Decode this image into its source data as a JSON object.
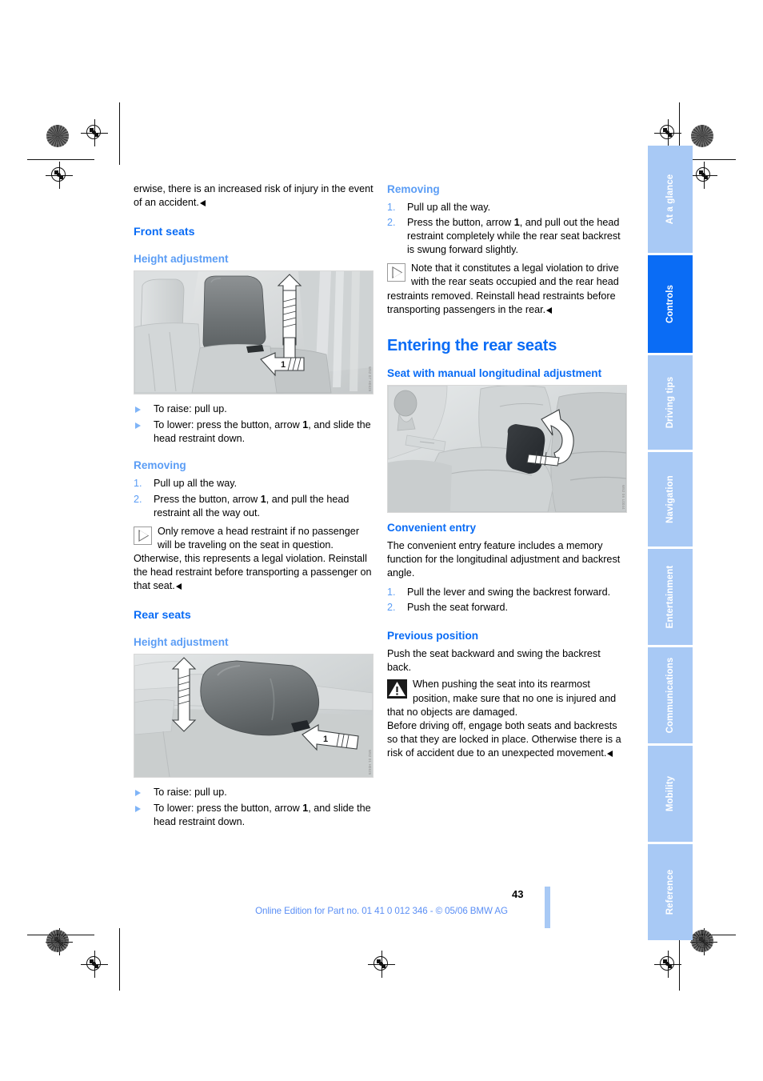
{
  "document": {
    "page_number": "43",
    "footer": "Online Edition for Part no. 01 41 0 012 346 - © 05/06 BMW AG"
  },
  "left_column": {
    "intro_paragraph": "erwise, there is an increased risk of injury in the event of an accident.",
    "front_seats_heading": "Front seats",
    "height_adjustment_heading": "Height adjustment",
    "figure_front_height": {
      "code": "W52 07 H0626",
      "alt": "Front seat head restraint with up/down arrow and button arrow 1"
    },
    "front_bullets": [
      "To raise: pull up.",
      "To lower: press the button, arrow 1, and slide the head restraint down."
    ],
    "removing_heading": "Removing",
    "removing_steps": [
      {
        "num": "1.",
        "text": "Pull up all the way."
      },
      {
        "num": "2.",
        "text": "Press the button, arrow 1, and pull the head restraint all the way out."
      }
    ],
    "removing_note": "Only remove a head restraint if no passenger will be traveling on the seat in question. Otherwise, this represents a legal violation. Reinstall the head restraint before transporting a passenger on that seat.",
    "rear_seats_heading": "Rear seats",
    "rear_height_adjustment_heading": "Height adjustment",
    "figure_rear_height": {
      "code": "W52 01 H0625",
      "alt": "Rear seat head restraint with up/down arrow and button arrow 1"
    },
    "rear_bullets": [
      "To raise: pull up.",
      "To lower: press the button, arrow 1, and slide the head restraint down."
    ]
  },
  "right_column": {
    "removing_heading": "Removing",
    "removing_steps": [
      {
        "num": "1.",
        "text": "Pull up all the way."
      },
      {
        "num": "2.",
        "text": "Press the button, arrow 1, and pull out the head restraint completely while the rear seat backrest is swung forward slightly."
      }
    ],
    "removing_note": "Note that it constitutes a legal violation to drive with the rear seats occupied and the rear head restraints removed. Reinstall head restraints before transporting passengers in the rear.",
    "entering_heading": "Entering the rear seats",
    "manual_adjustment_heading": "Seat with manual longitudinal adjustment",
    "figure_manual_adjustment": {
      "code": "W52 06 L0044",
      "alt": "Seat backrest release lever with curved arrow"
    },
    "convenient_entry_heading": "Convenient entry",
    "convenient_entry_paragraph": "The convenient entry feature includes a memory function for the longitudinal adjustment and backrest angle.",
    "convenient_entry_steps": [
      {
        "num": "1.",
        "text": "Pull the lever and swing the backrest forward."
      },
      {
        "num": "2.",
        "text": "Push the seat forward."
      }
    ],
    "previous_position_heading": "Previous position",
    "previous_position_paragraph": "Push the seat backward and swing the backrest back.",
    "warning_text": "When pushing the seat into its rearmost position, make sure that no one is injured and that no objects are damaged.",
    "warning_followup": "Before driving off, engage both seats and backrests so that they are locked in place. Otherwise there is a risk of accident due to an unexpected movement."
  },
  "sidebar": {
    "tabs": [
      {
        "label": "At a glance",
        "active": false
      },
      {
        "label": "Controls",
        "active": true
      },
      {
        "label": "Driving tips",
        "active": false
      },
      {
        "label": "Navigation",
        "active": false
      },
      {
        "label": "Entertainment",
        "active": false
      },
      {
        "label": "Communications",
        "active": false
      },
      {
        "label": "Mobility",
        "active": false
      },
      {
        "label": "Reference",
        "active": false
      }
    ],
    "colors": {
      "inactive": "#a8c9f5",
      "active": "#0a6cf5",
      "label": "#ffffff"
    }
  },
  "colors": {
    "heading_blue": "#0a6cf5",
    "subheading_blue": "#5b9df5",
    "body_black": "#000000",
    "footer_blue": "#5b8ff5"
  }
}
